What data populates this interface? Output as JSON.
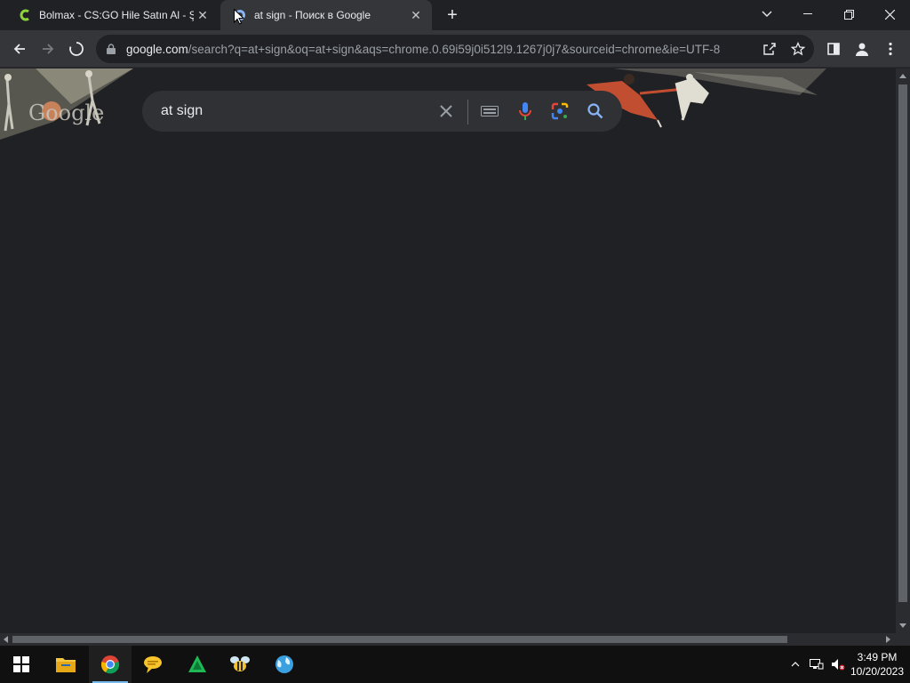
{
  "browser": {
    "tabs": [
      {
        "title": "Bolmax - CS:GO Hile Satın Al - Şi",
        "active": false,
        "favicon": "bolmax-logo-icon"
      },
      {
        "title": "at sign - Поиск в Google",
        "active": true,
        "favicon": "google-favicon-icon"
      }
    ],
    "address": {
      "domain": "google.com",
      "path": "/search?q=at+sign&oq=at+sign&aqs=chrome.0.69i59j0i512l9.1267j0j7&sourceid=chrome&ie=UTF-8"
    },
    "state": "loading"
  },
  "search": {
    "query": "at sign"
  },
  "doodle": {
    "logo_text": "Google"
  },
  "taskbar": {
    "time": "3:49 PM",
    "date": "10/20/2023"
  },
  "colors": {
    "background": "#202124",
    "toolbar": "#35363a",
    "searchbar": "#303134",
    "taskbar": "#101010"
  }
}
